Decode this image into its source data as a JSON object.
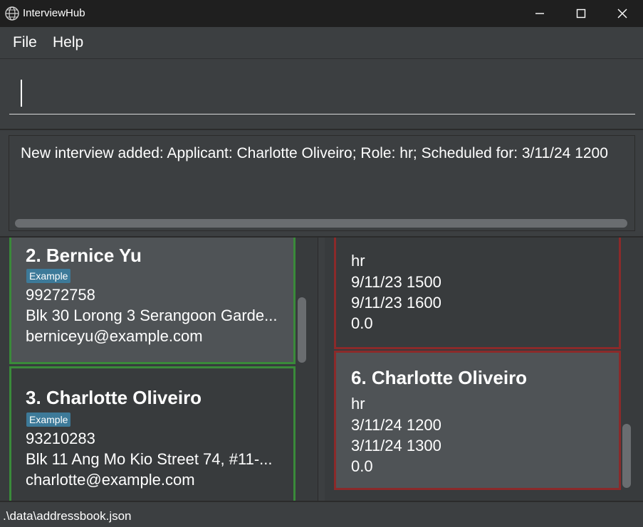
{
  "window": {
    "title": "InterviewHub",
    "icon": "globe-icon",
    "controls": [
      "minimize-icon",
      "maximize-icon",
      "close-icon"
    ]
  },
  "menu": {
    "file": "File",
    "help": "Help"
  },
  "command": {
    "value": ""
  },
  "result": {
    "text": "New interview added: Applicant: Charlotte Oliveiro; Role: hr; Scheduled for: 3/11/24 1200"
  },
  "persons": [
    {
      "index_name": "2.  Bernice Yu",
      "tag": "Example",
      "phone": "99272758",
      "address": "Blk 30 Lorong 3 Serangoon Garde...",
      "email": "berniceyu@example.com"
    },
    {
      "index_name": "3.  Charlotte Oliveiro",
      "tag": "Example",
      "phone": "93210283",
      "address": "Blk 11 Ang Mo Kio Street 74, #11-...",
      "email": "charlotte@example.com"
    }
  ],
  "interviews": [
    {
      "index_name": "",
      "role": "hr",
      "start": "9/11/23 1500",
      "end": "9/11/23 1600",
      "rating": "0.0"
    },
    {
      "index_name": "6.  Charlotte Oliveiro",
      "role": "hr",
      "start": "3/11/24 1200",
      "end": "3/11/24 1300",
      "rating": "0.0"
    }
  ],
  "status": {
    "path": ".\\data\\addressbook.json"
  },
  "colors": {
    "window_bg": "#3c3f41",
    "titlebar_bg": "#1f1f1f",
    "card_bg": "#4f5356",
    "person_border": "#3a8a3a",
    "interview_border": "#8b2a2a",
    "tag_bg": "#3d7a99"
  }
}
